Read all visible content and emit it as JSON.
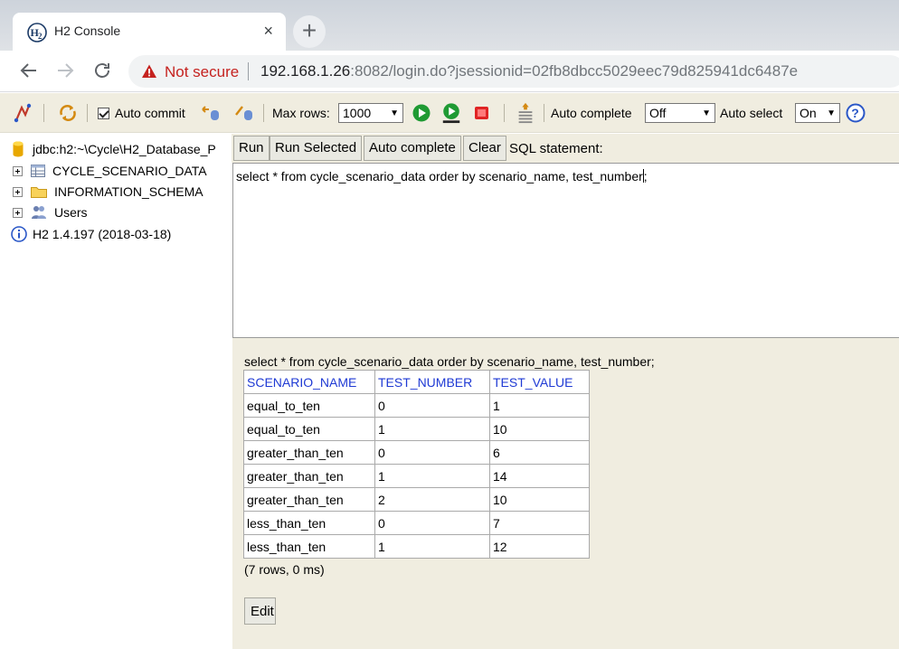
{
  "browser": {
    "tab_title": "H2 Console",
    "tab_close": "×",
    "new_tab": "+",
    "security_label": "Not secure",
    "url_host": "192.168.1.26",
    "url_rest": ":8082/login.do?jsessionid=02fb8dbcc5029eec79d825941dc6487e"
  },
  "toolbar": {
    "auto_commit_label": "Auto commit",
    "max_rows_label": "Max rows:",
    "max_rows_value": "1000",
    "auto_complete_label": "Auto complete",
    "auto_complete_value": "Off",
    "auto_select_label": "Auto select",
    "auto_select_value": "On",
    "dropdown_arrow": "▼"
  },
  "tree": {
    "connection": "jdbc:h2:~\\Cycle\\H2_Database_P",
    "items": [
      {
        "label": "CYCLE_SCENARIO_DATA"
      },
      {
        "label": "INFORMATION_SCHEMA"
      },
      {
        "label": "Users"
      }
    ],
    "version": "H2 1.4.197 (2018-03-18)"
  },
  "query": {
    "run_label": "Run",
    "run_selected_label": "Run Selected",
    "auto_complete_label": "Auto complete",
    "clear_label": "Clear",
    "statement_label": "SQL statement:",
    "sql_text": "select * from cycle_scenario_data order by scenario_name, test_number",
    "sql_tail": ";"
  },
  "results": {
    "echo": "select * from cycle_scenario_data order by scenario_name, test_number;",
    "columns": [
      "SCENARIO_NAME",
      "TEST_NUMBER",
      "TEST_VALUE"
    ],
    "rows": [
      [
        "equal_to_ten",
        "0",
        "1"
      ],
      [
        "equal_to_ten",
        "1",
        "10"
      ],
      [
        "greater_than_ten",
        "0",
        "6"
      ],
      [
        "greater_than_ten",
        "1",
        "14"
      ],
      [
        "greater_than_ten",
        "2",
        "10"
      ],
      [
        "less_than_ten",
        "0",
        "7"
      ],
      [
        "less_than_ten",
        "1",
        "12"
      ]
    ],
    "summary": "(7 rows, 0 ms)",
    "edit_label": "Edit"
  },
  "colors": {
    "h2_background": "#f0ede0",
    "column_header": "#1f3ad4",
    "not_secure": "#c5221f"
  }
}
